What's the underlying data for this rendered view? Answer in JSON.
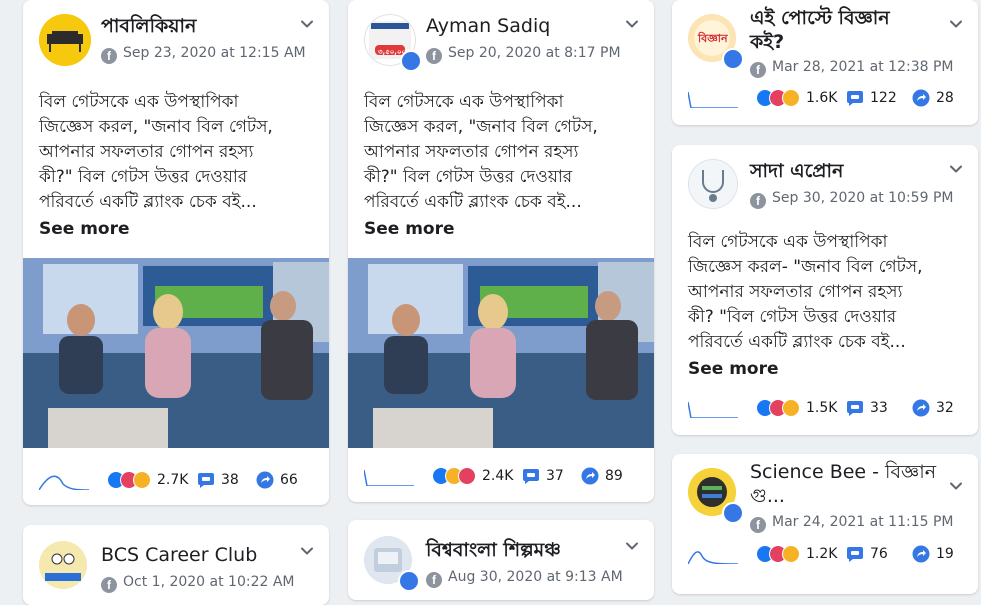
{
  "posts": [
    {
      "name": "পাবলিকিয়ান",
      "date": "Sep 23, 2020 at 12:15 AM",
      "text": "বিল গেটসকে এক উপস্থাপিকা\nজিজ্ঞেস করল, \"জনাব বিল গেটস,\nআপনার সফলতার গোপন রহস্য\nকী?\" বিল গেটস উত্তর দেওয়ার\nপরিবর্তে একটি ব্ল্যাংক চেক বই...",
      "see_more": "See more",
      "reactions": "2.7K",
      "comments": "38",
      "shares": "66"
    },
    {
      "name": "Ayman Sadiq",
      "date": "Sep 20, 2020 at 8:17 PM",
      "avatar_text": "৩,৫০,০০০",
      "text": "বিল গেটসকে এক উপস্থাপিকা\nজিজ্ঞেস করল, \"জনাব বিল গেটস,\nআপনার সফলতার গোপন রহস্য\nকী?\" বিল গেটস উত্তর দেওয়ার\nপরিবর্তে একটি ব্ল্যাংক চেক বই...",
      "see_more": "See more",
      "reactions": "2.4K",
      "comments": "37",
      "shares": "89"
    },
    {
      "name": "এই পোস্টে বিজ্ঞান\nকই?",
      "date": "Mar 28, 2021 at 12:38 PM",
      "reactions": "1.6K",
      "comments": "122",
      "shares": "28"
    },
    {
      "name": "সাদা এপ্রোন",
      "date": "Sep 30, 2020 at 10:59 PM",
      "text": "বিল গেটসকে এক উপস্থাপিকা\nজিজ্ঞেস করল- \"জনাব বিল গেটস,\nআপনার সফলতার গোপন রহস্য\nকী? \"বিল গেটস উত্তর দেওয়ার\nপরিবর্তে একটি ব্ল্যাংক চেক বই...",
      "see_more": "See more",
      "reactions": "1.5K",
      "comments": "33",
      "shares": "32"
    },
    {
      "name": "Science Bee - বিজ্ঞান\nগু...",
      "date": "Mar 24, 2021 at 11:15 PM",
      "reactions": "1.2K",
      "comments": "76",
      "shares": "19"
    },
    {
      "name": "BCS Career Club",
      "date": "Oct 1, 2020 at 10:22 AM"
    },
    {
      "name": "বিশ্ববাংলা শিল্পমঞ্চ",
      "date": "Aug 30, 2020 at 9:13 AM"
    }
  ],
  "icons": {
    "platform": "facebook-icon",
    "menu": "chevron-down-icon",
    "comment": "comment-icon",
    "share": "share-icon",
    "trend": "sparkline-icon"
  },
  "colors": {
    "brand": "#3578e5",
    "like": "#1877f2",
    "haha": "#f7b125",
    "love": "#e4405f",
    "background": "#edf0f3"
  }
}
